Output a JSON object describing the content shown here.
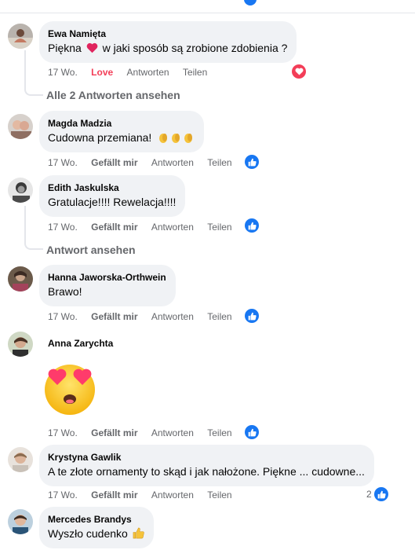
{
  "comments": [
    {
      "author": "Ewa Namięta",
      "text_pre": "Piękna",
      "text_post": "w jaki sposób są zrobione zdobienia ?",
      "time": "17 Wo.",
      "reaction": "Love",
      "reply": "Antworten",
      "share": "Teilen",
      "more_replies": "Alle 2 Antworten ansehen"
    },
    {
      "author": "Magda Madzia",
      "text": "Cudowna przemiana!",
      "time": "17 Wo.",
      "like": "Gefällt mir",
      "reply": "Antworten",
      "share": "Teilen"
    },
    {
      "author": "Edith Jaskulska",
      "text": "Gratulacje!!!! Rewelacja!!!!",
      "time": "17 Wo.",
      "like": "Gefällt mir",
      "reply": "Antworten",
      "share": "Teilen",
      "more_replies": "Antwort ansehen"
    },
    {
      "author": "Hanna Jaworska-Orthwein",
      "text": "Brawo!",
      "time": "17 Wo.",
      "like": "Gefällt mir",
      "reply": "Antworten",
      "share": "Teilen"
    },
    {
      "author": "Anna Zarychta",
      "time": "17 Wo.",
      "like": "Gefällt mir",
      "reply": "Antworten",
      "share": "Teilen"
    },
    {
      "author": "Krystyna Gawlik",
      "text": "A te złote ornamenty to skąd i jak nałożone. Piękne ... cudowne...",
      "time": "17 Wo.",
      "like": "Gefällt mir",
      "reply": "Antworten",
      "share": "Teilen",
      "reaction_count": "2"
    },
    {
      "author": "Mercedes Brandys",
      "text": "Wyszło cudenko"
    }
  ],
  "colors": {
    "like_blue": "#1877f2",
    "love_red": "#f33e58",
    "bubble": "#f0f2f5",
    "meta": "#65676b"
  },
  "icons": {
    "heart": "heart-icon",
    "like": "thumbs-up-icon",
    "clap": "clapping-hands-icon",
    "sticker": "heart-eyes-emoji",
    "thumb_emoji": "thumbs-up-emoji"
  }
}
